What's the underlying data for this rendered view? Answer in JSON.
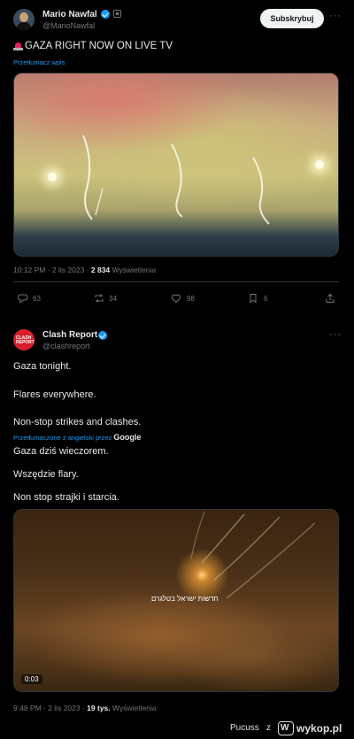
{
  "tweet1": {
    "author_name": "Mario Nawfal",
    "author_handle": "@MarioNawfal",
    "subscribe_label": "Subskrybuj",
    "more_label": "···",
    "text": "GAZA RIGHT NOW ON LIVE TV",
    "siren_icon": "police-light-emoji",
    "translate_label": "Przetłumacz wpis",
    "time": "10:12 PM · 2 lis 2023 ·",
    "views_count": "2 834",
    "views_label": "Wyświetlenia",
    "actions": {
      "replies": "63",
      "reposts": "34",
      "likes": "98",
      "bookmarks": "6"
    }
  },
  "tweet2": {
    "author_name": "Clash Report",
    "author_handle": "@clashreport",
    "more_label": "···",
    "avatar_text": "CLASH REPORT",
    "lines": [
      "Gaza tonight.",
      "Flares everywhere.",
      "Non-stop strikes and clashes."
    ],
    "translated_by": "Przetłumaczone z angielski przez",
    "translated_by_brand": "Google",
    "translated_lines": [
      "Gaza dziś wieczorem.",
      "Wszędzie flary.",
      "Non stop strajki i starcia."
    ],
    "video_watermark": "חדשות ישראל בטלגרם",
    "video_duration": "0:03",
    "time": "9:48 PM · 2 lis 2023 ·",
    "views_count": "19 tys.",
    "views_label": "Wyświetlenia"
  },
  "footer": {
    "source_text": "Pucuss",
    "z_text": "z",
    "site_name": "wykop.pl"
  },
  "colors": {
    "background": "#000000",
    "text_primary": "#e7e9ea",
    "text_secondary": "#71767b",
    "link_blue": "#1d9bf0",
    "verified_blue": "#1d9bf0",
    "divider": "#2f3336"
  }
}
